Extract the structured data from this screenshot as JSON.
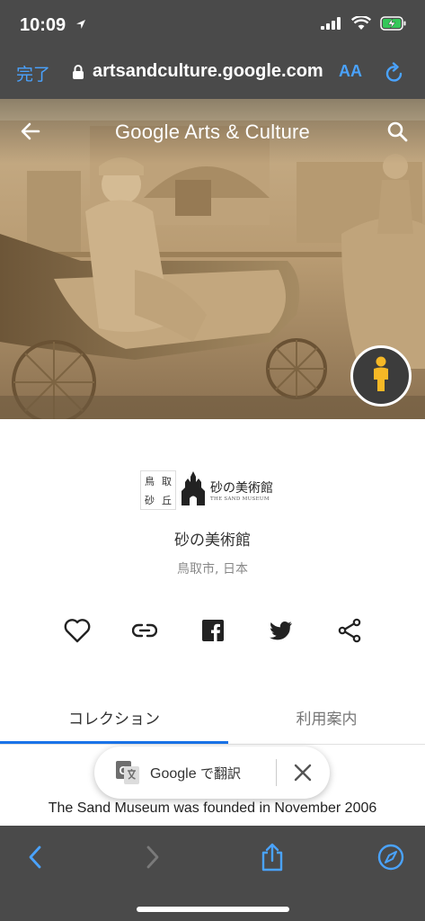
{
  "status_bar": {
    "time": "10:09",
    "icons": [
      "location-arrow-icon",
      "cellular-signal-icon",
      "wifi-icon",
      "battery-charging-icon"
    ]
  },
  "browser": {
    "done_label": "完了",
    "url": "artsandculture.google.com",
    "text_size_label": "AA",
    "icons": [
      "lock-icon",
      "reload-icon"
    ]
  },
  "header": {
    "brand_google": "Google",
    "brand_rest": "Arts & Culture",
    "icons": [
      "back-arrow-icon",
      "search-icon"
    ]
  },
  "hero": {
    "image_description_icon": "sand-sculpture-photo",
    "street_view_icon": "pegman-icon"
  },
  "partner": {
    "logo": {
      "kanji": [
        "鳥",
        "取",
        "砂",
        "丘"
      ],
      "title": "砂の美術館",
      "subtitle": "THE SAND MUSEUM"
    },
    "name": "砂の美術館",
    "location": "鳥取市, 日本"
  },
  "share": {
    "icons": [
      "heart-icon",
      "link-icon",
      "facebook-icon",
      "twitter-icon",
      "share-icon"
    ]
  },
  "tabs": [
    {
      "label": "コレクション",
      "active": true
    },
    {
      "label": "利用案内",
      "active": false
    }
  ],
  "translate": {
    "brand": "Google",
    "label": "で翻訳",
    "icons": [
      "google-translate-icon",
      "close-icon"
    ]
  },
  "description": "The Sand Museum was founded in November 2006",
  "toolbar": {
    "icons": [
      "back-chevron-icon",
      "forward-chevron-icon",
      "share-upload-icon",
      "compass-icon"
    ]
  },
  "colors": {
    "chrome": "#4a4a4a",
    "ios_blue": "#4aa3ff",
    "accent_blue": "#1a73e8",
    "pegman_yellow": "#f6b826"
  }
}
